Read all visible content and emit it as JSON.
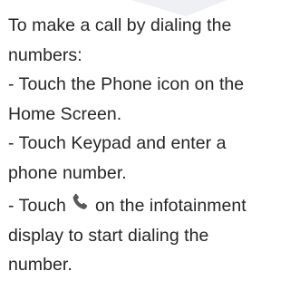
{
  "instructions": {
    "line1": "To make a call by dialing the",
    "line2": "numbers:",
    "line3": "- Touch the Phone icon on the",
    "line4": "Home Screen.",
    "line5": "- Touch Keypad and enter a",
    "line6": "phone number.",
    "line7_before_icon": "- Touch",
    "line7_after_icon": "on the infotainment",
    "line8": "display to start dialing the",
    "line9": "number."
  },
  "icons": {
    "inline_call": "phone-handset-icon"
  },
  "colors": {
    "text": "#262626",
    "phone_icon": "#58595b",
    "corner_shape": "#eef0f4"
  }
}
